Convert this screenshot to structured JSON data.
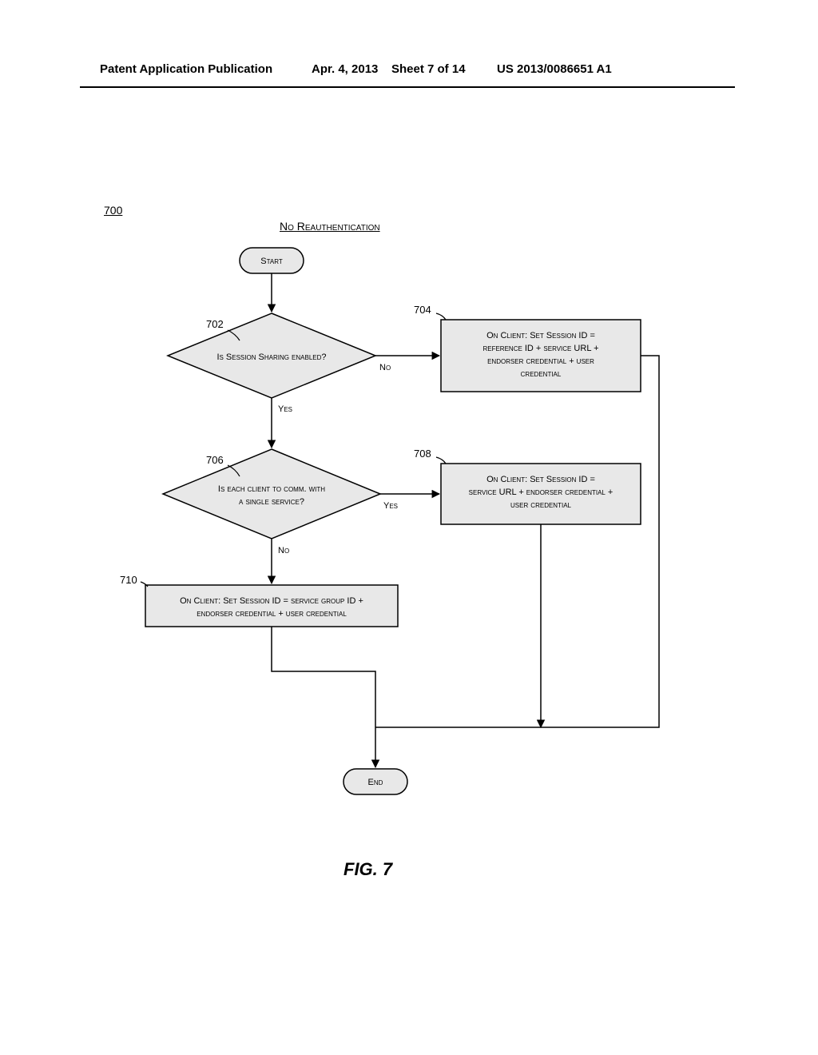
{
  "header": {
    "left": "Patent Application Publication",
    "date": "Apr. 4, 2013",
    "sheet": "Sheet 7 of 14",
    "pubno": "US 2013/0086651 A1"
  },
  "figure": {
    "ref": "700",
    "title": "No Reauthentication",
    "label": "FIG. 7"
  },
  "chart_data": {
    "type": "flowchart",
    "nodes": [
      {
        "id": "start",
        "kind": "terminator",
        "text": "Start"
      },
      {
        "id": "702",
        "kind": "decision",
        "ref": "702",
        "text": "Is Session Sharing enabled?"
      },
      {
        "id": "704",
        "kind": "process",
        "ref": "704",
        "text": "On Client: Set Session ID = reference ID + service URL + endorser credential + user credential"
      },
      {
        "id": "706",
        "kind": "decision",
        "ref": "706",
        "text": "Is each client to comm. with a single service?"
      },
      {
        "id": "708",
        "kind": "process",
        "ref": "708",
        "text": "On Client: Set Session ID = service URL + endorser credential + user credential"
      },
      {
        "id": "710",
        "kind": "process",
        "ref": "710",
        "text": "On Client: Set Session ID = service group ID + endorser credential + user credential"
      },
      {
        "id": "end",
        "kind": "terminator",
        "text": "End"
      }
    ],
    "edges": [
      {
        "from": "start",
        "to": "702"
      },
      {
        "from": "702",
        "to": "704",
        "label": "No"
      },
      {
        "from": "702",
        "to": "706",
        "label": "Yes"
      },
      {
        "from": "706",
        "to": "708",
        "label": "Yes"
      },
      {
        "from": "706",
        "to": "710",
        "label": "No"
      },
      {
        "from": "704",
        "to": "end"
      },
      {
        "from": "708",
        "to": "end"
      },
      {
        "from": "710",
        "to": "end"
      }
    ],
    "labels": {
      "yes": "Yes",
      "no": "No"
    }
  }
}
